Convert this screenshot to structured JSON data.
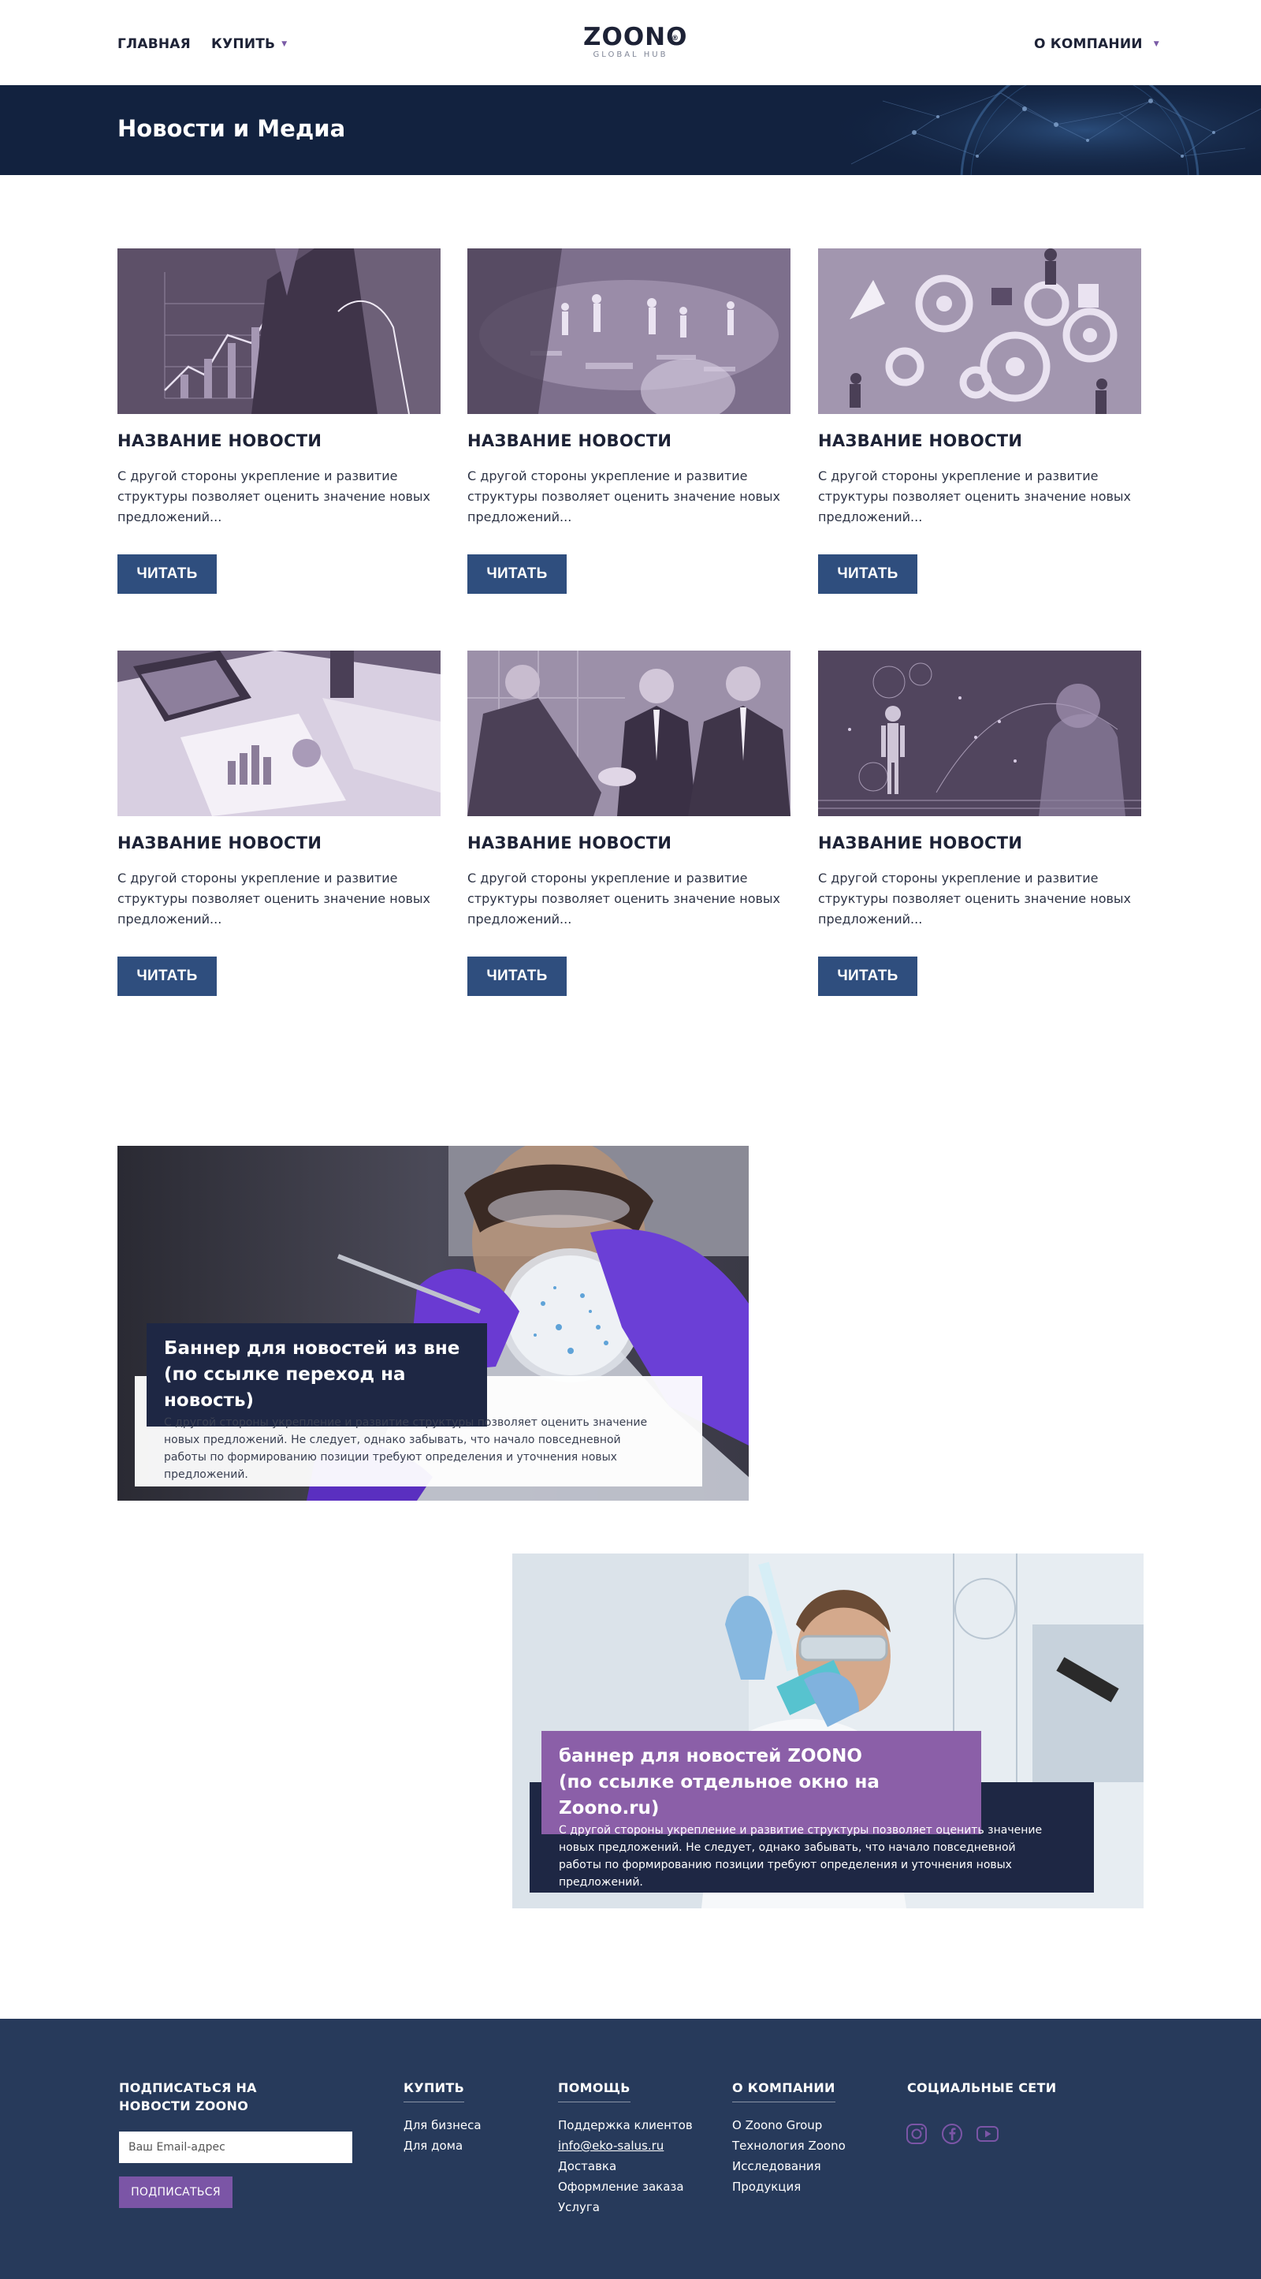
{
  "header": {
    "nav_home": "ГЛАВНАЯ",
    "nav_buy": "КУПИТЬ",
    "nav_company": "О КОМПАНИИ",
    "logo_text": "ZOONO",
    "logo_mark": "®",
    "logo_sub": "GLOBAL HUB"
  },
  "hero": {
    "title": "Новости и Медиа"
  },
  "news": [
    {
      "title": "НАЗВАНИЕ НОВОСТИ",
      "text": "С другой стороны укрепление и развитие структуры позволяет оценить значение новых предложений...",
      "button": "ЧИТАТЬ"
    },
    {
      "title": "НАЗВАНИЕ НОВОСТИ",
      "text": "С другой стороны укрепление и развитие структуры позволяет оценить значение новых предложений...",
      "button": "ЧИТАТЬ"
    },
    {
      "title": "НАЗВАНИЕ НОВОСТИ",
      "text": "С другой стороны укрепление и развитие структуры позволяет оценить значение новых предложений...",
      "button": "ЧИТАТЬ"
    },
    {
      "title": "НАЗВАНИЕ НОВОСТИ",
      "text": "С другой стороны укрепление и развитие структуры позволяет оценить значение новых предложений...",
      "button": "ЧИТАТЬ"
    },
    {
      "title": "НАЗВАНИЕ НОВОСТИ",
      "text": "С другой стороны укрепление и развитие структуры позволяет оценить значение новых предложений...",
      "button": "ЧИТАТЬ"
    },
    {
      "title": "НАЗВАНИЕ НОВОСТИ",
      "text": "С другой стороны укрепление и развитие структуры позволяет оценить значение новых предложений...",
      "button": "ЧИТАТЬ"
    }
  ],
  "banner_external": {
    "head_line1": "Баннер для новостей из вне",
    "head_line2": "(по ссылке переход на новость)",
    "text": "С другой стороны укрепление и развитие структуры позволяет оценить значение новых предложений. Не следует, однако забывать, что начало повседневной работы по формированию позиции требуют определения и уточнения новых предложений."
  },
  "banner_zoono": {
    "head_line1": "баннер для новостей ZOONO",
    "head_line2": "(по ссылке отдельное окно на Zoono.ru)",
    "text": "С другой стороны укрепление и развитие структуры позволяет оценить значение новых предложений. Не следует, однако забывать, что начало повседневной работы по формированию позиции требуют определения и уточнения новых предложений."
  },
  "footer": {
    "subscribe_line1": "ПОДПИСАТЬСЯ НА",
    "subscribe_line2": "НОВОСТИ ZOONO",
    "email_placeholder": "Ваш Email-адрес",
    "subscribe_button": "ПОДПИСАТЬСЯ",
    "buy_title": "КУПИТЬ",
    "buy_links": [
      "Для бизнеса",
      "Для дома"
    ],
    "help_title": "ПОМОЩЬ",
    "help_links": [
      "Поддержка клиентов",
      "info@eko-salus.ru",
      "Доставка",
      "Оформление заказа",
      "Услуга"
    ],
    "company_title": "О КОМПАНИИ",
    "company_links": [
      "О Zoono Group",
      "Технология Zoono",
      "Исследования",
      "Продукция"
    ],
    "social_title": "СОЦИАЛЬНЫЕ СЕТИ",
    "social_icons": [
      "instagram-icon",
      "facebook-icon",
      "youtube-icon"
    ]
  },
  "colors": {
    "navy": "#12223f",
    "footer": "#273a5b",
    "button": "#2f4e7e",
    "purple": "#7b55a6"
  }
}
